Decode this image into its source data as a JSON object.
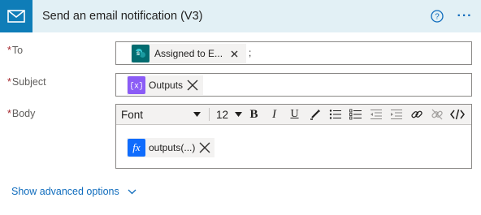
{
  "header": {
    "title": "Send an email notification (V3)",
    "icon": "mail-icon",
    "bg_color": "#e2f0f5",
    "icon_bg_color": "#0f7db8",
    "help_icon": "help-circle-icon",
    "more_label": "···"
  },
  "fields": {
    "to": {
      "required_mark": "*",
      "label": "To",
      "token_label": "Assigned to E...",
      "token_icon": "sharepoint-icon",
      "token_color": "#036c70",
      "trailing_text": ";"
    },
    "subject": {
      "required_mark": "*",
      "label": "Subject",
      "token_label": "Outputs",
      "token_icon": "variable-icon",
      "token_color": "#8b5cf6"
    },
    "body": {
      "required_mark": "*",
      "label": "Body",
      "token_label": "outputs(...)",
      "token_icon": "function-icon",
      "token_color": "#0f6cfd"
    }
  },
  "toolbar": {
    "font_value": "Font",
    "size_value": "12",
    "buttons": [
      "bold-icon",
      "italic-icon",
      "underline-icon",
      "highlight-icon",
      "bulleted-list-icon",
      "numbered-list-icon",
      "decrease-indent-icon",
      "increase-indent-icon",
      "link-icon",
      "unlink-icon",
      "code-view-icon"
    ]
  },
  "advanced": {
    "label": "Show advanced options"
  }
}
